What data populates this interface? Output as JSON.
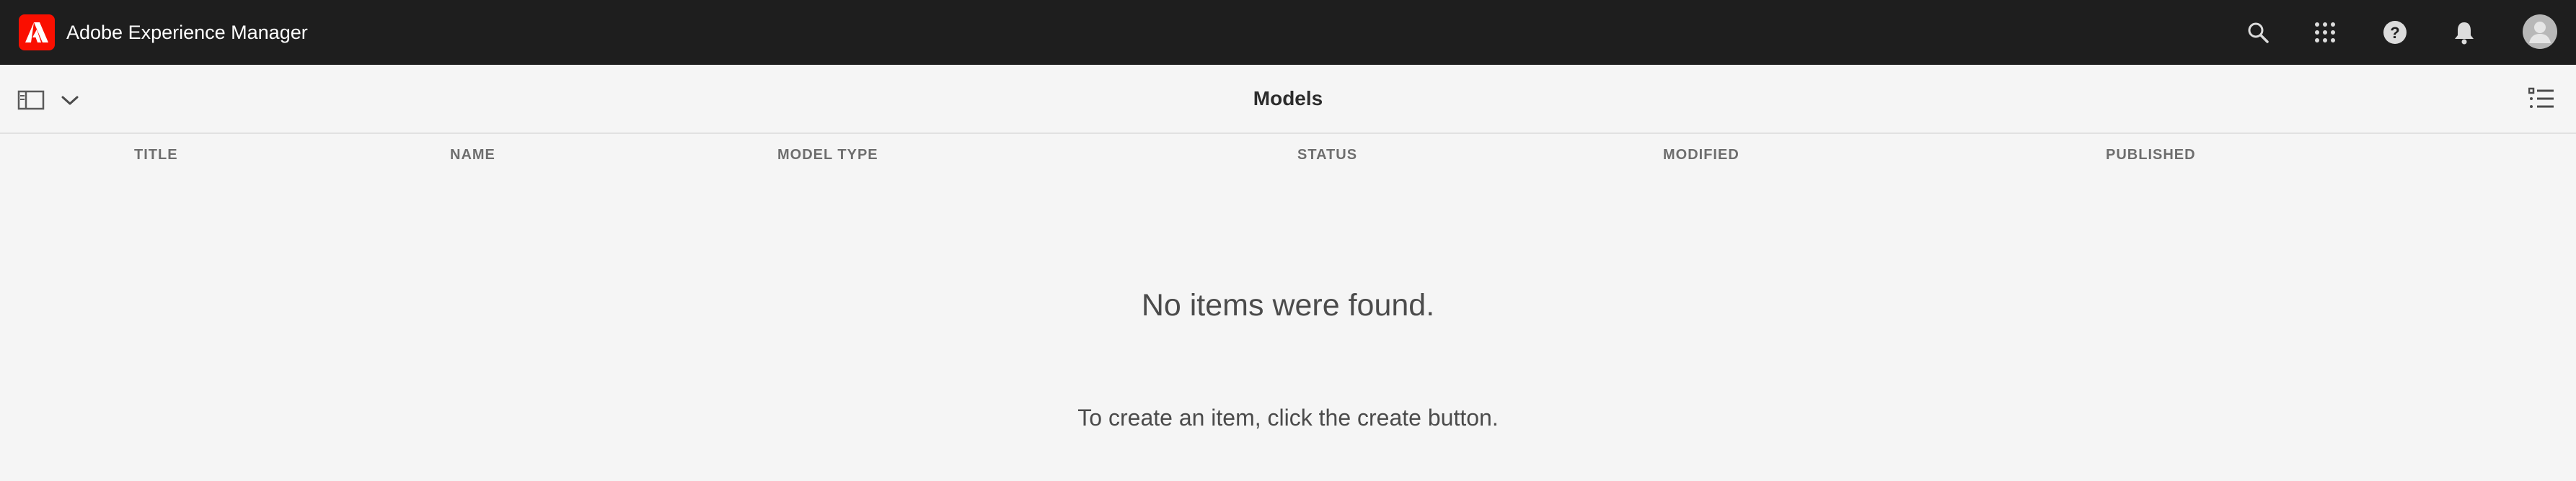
{
  "app": {
    "title": "Adobe Experience Manager"
  },
  "topbar": {
    "icons": [
      "search-icon",
      "apps-grid-icon",
      "help-icon",
      "notifications-bell-icon",
      "user-avatar"
    ]
  },
  "toolbar": {
    "page_title": "Models"
  },
  "table": {
    "columns": [
      "TITLE",
      "NAME",
      "MODEL TYPE",
      "STATUS",
      "MODIFIED",
      "PUBLISHED"
    ]
  },
  "empty_state": {
    "title": "No items were found.",
    "message": "To create an item, click the create button."
  },
  "colors": {
    "topbar_bg": "#1e1e1e",
    "page_bg": "#f5f5f5",
    "logo_red": "#fa0f00"
  }
}
